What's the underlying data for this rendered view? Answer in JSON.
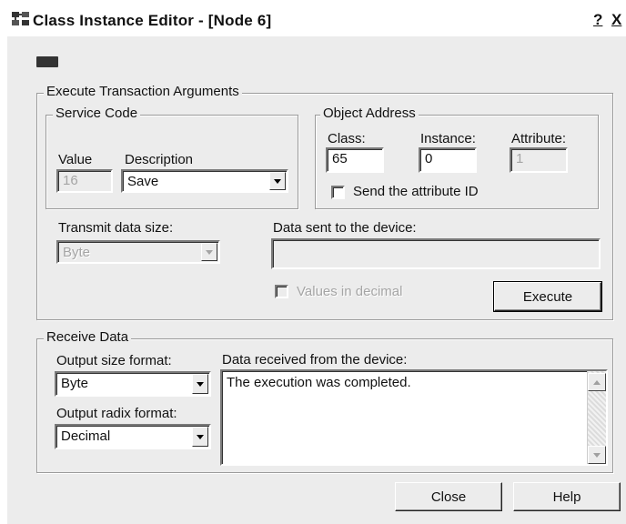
{
  "window": {
    "title": "Class Instance Editor - [Node 6]",
    "help_glyph": "?",
    "close_glyph": "X"
  },
  "transaction": {
    "legend": "Execute Transaction Arguments",
    "service_code": {
      "legend": "Service Code",
      "value_label": "Value",
      "value": "16",
      "description_label": "Description",
      "description": "Save"
    },
    "object_address": {
      "legend": "Object Address",
      "class_label": "Class:",
      "class_value": "65",
      "instance_label": "Instance:",
      "instance_value": "0",
      "attribute_label": "Attribute:",
      "attribute_value": "1",
      "send_attr_label": "Send the attribute ID"
    },
    "transmit_size_label": "Transmit data size:",
    "transmit_size_value": "Byte",
    "data_sent_label": "Data sent to the device:",
    "data_sent_value": "",
    "values_decimal_label": "Values in decimal",
    "execute_label": "Execute"
  },
  "receive": {
    "legend": "Receive Data",
    "output_size_label": "Output size format:",
    "output_size_value": "Byte",
    "output_radix_label": "Output radix format:",
    "output_radix_value": "Decimal",
    "data_received_label": "Data received from the device:",
    "data_received_text": "The execution was completed."
  },
  "buttons": {
    "close": "Close",
    "help": "Help"
  }
}
